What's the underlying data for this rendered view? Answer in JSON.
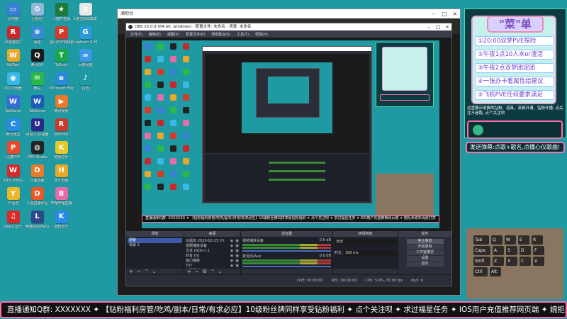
{
  "desktop_icons": [
    {
      "label": "此电脑",
      "color": "#3a7fd6",
      "glyph": "▭"
    },
    {
      "label": "回收站",
      "color": "#8fb8d8",
      "glyph": "♻"
    },
    {
      "label": "小鹿开盒器",
      "color": "#1e7a3a",
      "glyph": "★"
    },
    {
      "label": "1盘古启动脚本.bat",
      "color": "#e8e8e8",
      "glyph": "≡"
    },
    {
      "label": "红色警戒2",
      "color": "#c8282c",
      "glyph": "R"
    },
    {
      "label": "网络",
      "color": "#3a8ad6",
      "glyph": "⊕"
    },
    {
      "label": "蓝山PDF转换器",
      "color": "#d83a2a",
      "glyph": "P"
    },
    {
      "label": "Logitech G HUB",
      "color": "#2a9ad8",
      "glyph": "G"
    },
    {
      "label": "WeTest",
      "color": "#e8a82a",
      "glyph": "W"
    },
    {
      "label": "腾讯QQ",
      "color": "#1a1a1a",
      "glyph": "Q"
    },
    {
      "label": "ToDesk",
      "color": "#1aa84a",
      "glyph": "T"
    },
    {
      "label": "百度网盘",
      "color": "#3a9ae8",
      "glyph": "∞"
    },
    {
      "label": "QQ 浏览器",
      "color": "#3ab8e8",
      "glyph": "◉"
    },
    {
      "label": "微信",
      "color": "#2ab84a",
      "glyph": "✉"
    },
    {
      "label": "Microsoft Edge",
      "color": "#2a8ad8",
      "glyph": "e"
    },
    {
      "label": "抖音",
      "color": "#1f9aa3",
      "glyph": "♪"
    },
    {
      "label": "WeGame",
      "color": "#3a6ad8",
      "glyph": "W"
    },
    {
      "label": "WeGame",
      "color": "#1a5ab8",
      "glyph": "W"
    },
    {
      "label": "腾讯视频",
      "color": "#e87a2a",
      "glyph": "▶"
    },
    {
      "label": "",
      "color": "#1f9aa3",
      "glyph": ""
    },
    {
      "label": "腾讯课堂",
      "color": "#2a8ae8",
      "glyph": "C"
    },
    {
      "label": "网易UU加速器",
      "color": "#2a2a8a",
      "glyph": "U"
    },
    {
      "label": "REAPER",
      "color": "#c83a2a",
      "glyph": "R"
    },
    {
      "label": "",
      "color": "#1f9aa3",
      "glyph": ""
    },
    {
      "label": "迅捷PDF",
      "color": "#e84a2a",
      "glyph": "P"
    },
    {
      "label": "OBS Studio",
      "color": "#222222",
      "glyph": "◍"
    },
    {
      "label": "酷我音乐",
      "color": "#e8c82a",
      "glyph": "K"
    },
    {
      "label": "",
      "color": "#1f9aa3",
      "glyph": ""
    },
    {
      "label": "WPS Office",
      "color": "#d82a2a",
      "glyph": "W"
    },
    {
      "label": "斗鱼直播",
      "color": "#e87a2a",
      "glyph": "D"
    },
    {
      "label": "虎牙直播",
      "color": "#e8a82a",
      "glyph": "H"
    },
    {
      "label": "",
      "color": "#1f9aa3",
      "glyph": ""
    },
    {
      "label": "YY语音",
      "color": "#e8b82a",
      "glyph": "Y"
    },
    {
      "label": "斗鱼直播伴侣",
      "color": "#e85a2a",
      "glyph": "D"
    },
    {
      "label": "哔哩哔哩直播",
      "color": "#e86aa8",
      "glyph": "B"
    },
    {
      "label": "",
      "color": "#1f9aa3",
      "glyph": ""
    },
    {
      "label": "网易云音乐",
      "color": "#d82a2a",
      "glyph": "♫"
    },
    {
      "label": "英雄联盟WeGame版",
      "color": "#2a4a8a",
      "glyph": "L"
    },
    {
      "label": "酷狗音乐",
      "color": "#2a8ae8",
      "glyph": "K"
    }
  ],
  "outer_window": {
    "title": "酒吧台"
  },
  "obs": {
    "title": "OBS 25.0.8 (64-bit, windows) - 配置文件: 未命名 - 场景: 未命名",
    "menu": [
      "文件(F)",
      "编辑(E)",
      "视图(V)",
      "配置文件(P)",
      "场景集合(S)",
      "工具(T)",
      "帮助(H)"
    ],
    "docks": {
      "scenes": {
        "title": "场景",
        "items": [
          "场景",
          "场景 2"
        ]
      },
      "sources": {
        "title": "来源",
        "items": [
          "ttl副本·2020-02-23 (?) 2003",
          "视频捕获设备",
          "文本 (GDI+) 2",
          "抖音 (tt)",
          "窗口捕获",
          "TXT",
          "全屏幕捕获"
        ]
      },
      "mixer": {
        "title": "混音器",
        "tracks": [
          {
            "name": "视频捕获设备",
            "db": "0.0 dB"
          },
          {
            "name": "麦克风/Aux",
            "db": "0.0 dB"
          }
        ]
      },
      "transitions": {
        "title": "转场特效",
        "type": "淡出",
        "duration_label": "时长",
        "duration_value": "300 ms"
      },
      "controls": {
        "title": "控件",
        "buttons": [
          "停止推流",
          "开始录制",
          "工作室模式",
          "设置",
          "退出"
        ]
      }
    },
    "status": {
      "live": "LIVE: 00:00:00",
      "rec": "REC: 00:00:00",
      "cpu": "CPU: 5.9%, 30.00 fps",
      "kbps": "kb/s: 0"
    }
  },
  "ticker": {
    "text": "直播通知Q群: XXXXXXX  ✦  【钻粉福利房管/吃鸡/副本/日常/有求必应】10级粉丝牌同样享受钻粉福利  ✦  点个关注呗  ✦  求过福星任务  ✦  IOS用户充值推荐网页端  ✦  婉拒未成年消费打赏"
  },
  "menu_card": {
    "title": "\"菜\"单",
    "items": [
      "①20:00双梦PVE探险",
      "②午夜1点10人本or渣活",
      "③午夜2点双梦团定团",
      "④一张办卡看属性给建议",
      "⑤飞机PVE任何要求满足"
    ]
  },
  "announcement": "运营展示收费的钻粉、道具、亲族开通、钻粉开播, 点关注不迷路, 点个关注呗",
  "danmu_hint": "发送弹幕:点歌+歌名,点播心仪歌曲!",
  "keyboard_keys": [
    "Tab",
    "Q",
    "W",
    "E",
    "R",
    "Caps",
    "A",
    "S",
    "D",
    "F",
    "Shift",
    "Z",
    "X",
    "C",
    "V",
    "Ctrl",
    "Alt"
  ]
}
